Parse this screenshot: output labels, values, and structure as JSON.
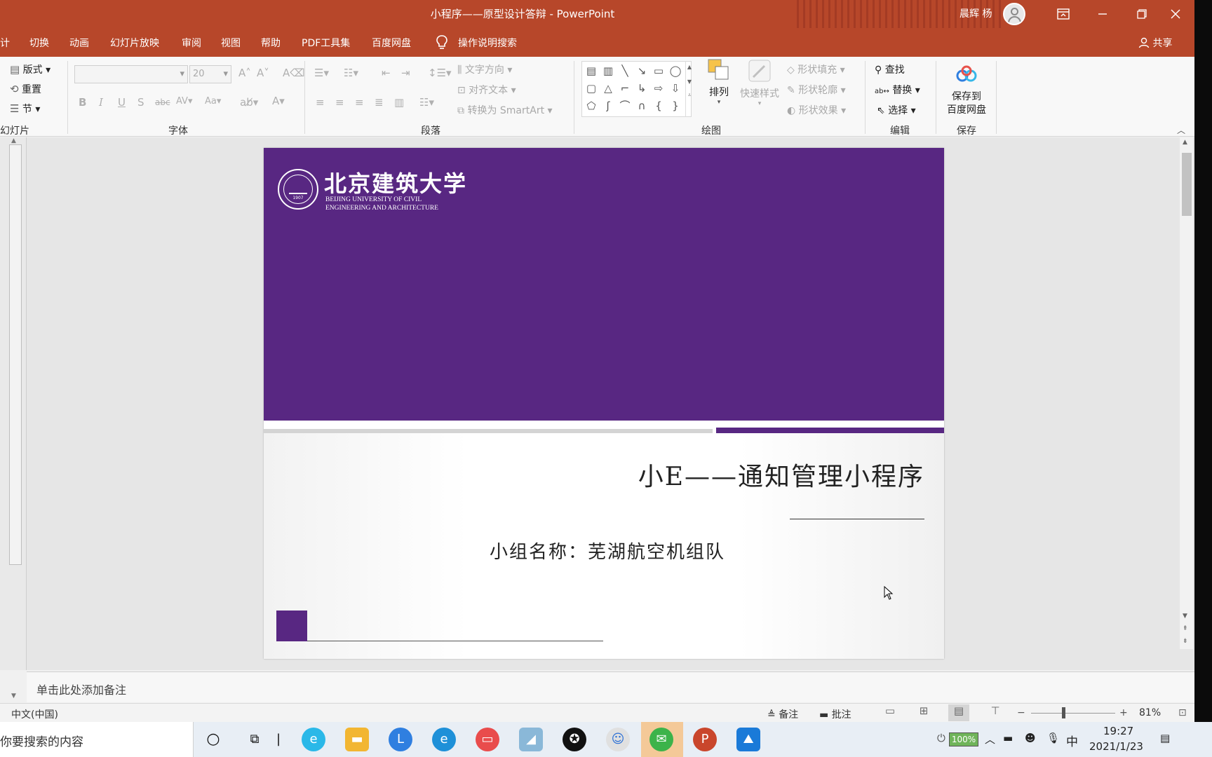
{
  "window": {
    "title": "小程序——原型设计答辩 - PowerPoint",
    "user_name": "晨辉 杨"
  },
  "menu": {
    "tabs": [
      "计",
      "切换",
      "动画",
      "幻灯片放映",
      "审阅",
      "视图",
      "帮助",
      "PDF工具集",
      "百度网盘"
    ],
    "tell_me": "操作说明搜索",
    "share": "共享"
  },
  "ribbon": {
    "slides": {
      "layout": "版式",
      "reset": "重置",
      "section": "节",
      "label": "幻灯片"
    },
    "font": {
      "size": "20",
      "label": "字体"
    },
    "paragraph": {
      "text_direction": "文字方向",
      "align_text": "对齐文本",
      "smartart": "转换为 SmartArt",
      "label": "段落"
    },
    "drawing": {
      "arrange": "排列",
      "quick_styles": "快速样式",
      "shape_fill": "形状填充",
      "shape_outline": "形状轮廓",
      "shape_effects": "形状效果",
      "label": "绘图"
    },
    "editing": {
      "find": "查找",
      "replace": "替换",
      "select": "选择",
      "label": "编辑"
    },
    "save": {
      "button_line1": "保存到",
      "button_line2": "百度网盘",
      "label": "保存"
    }
  },
  "slide": {
    "university_cn": "北京建筑大学",
    "university_en_line1": "BEIJING UNIVERSITY OF CIVIL",
    "university_en_line2": "ENGINEERING AND ARCHITECTURE",
    "seal_year": "1907",
    "title": "小E——通知管理小程序",
    "subtitle": "小组名称：芜湖航空机组队",
    "accent_color": "#582782"
  },
  "notes": {
    "placeholder": "单击此处添加备注"
  },
  "status": {
    "language": "中文(中国)",
    "notes_btn": "备注",
    "comments_btn": "批注",
    "zoom": "81%"
  },
  "taskbar": {
    "search_text": "你要搜索的内容",
    "battery": "100%",
    "ime": "中",
    "time": "19:27",
    "date": "2021/1/23"
  }
}
